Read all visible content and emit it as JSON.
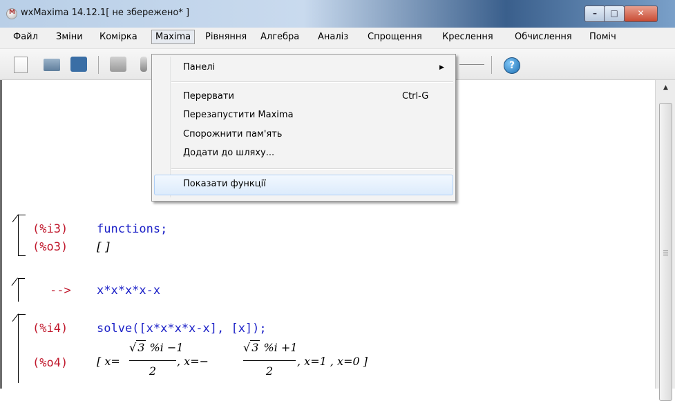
{
  "window": {
    "title": "wxMaxima 14.12.1[ не збережено* ]",
    "controls": {
      "minimize": "–",
      "maximize": "□",
      "close": "✕"
    }
  },
  "menubar": {
    "items": [
      "Файл",
      "Зміни",
      "Комірка",
      "Maxima",
      "Рівняння",
      "Алгебра",
      "Аналіз",
      "Спрощення",
      "Креслення",
      "Обчислення",
      "Поміч"
    ],
    "active": "Maxima"
  },
  "toolbar": {
    "icons": [
      "new-document-icon",
      "open-folder-icon",
      "save-icon",
      "print-icon",
      "settings-icon",
      "help-icon"
    ],
    "help_glyph": "?"
  },
  "dropdown": {
    "items": [
      {
        "label": "Панелі",
        "submenu_arrow": "▶"
      },
      {
        "label": "Перервати",
        "shortcut": "Ctrl-G"
      },
      {
        "label": "Перезапустити Maxima"
      },
      {
        "label": "Спорожнити пам'ять"
      },
      {
        "label": "Додати до шляху..."
      },
      {
        "label": "Показати функції",
        "highlighted": true
      }
    ]
  },
  "worksheet": {
    "cell1": {
      "input_label": "(%i3)",
      "input": "functions;",
      "output_label": "(%o3)",
      "output": "[ ]"
    },
    "cell2": {
      "prompt": "-->",
      "input": "x*x*x*x-x"
    },
    "cell3": {
      "input_label": "(%i4)",
      "input": "solve([x*x*x*x-x], [x]);",
      "output_label": "(%o4)",
      "out_open": "[ x=",
      "frac1_sqrt": "3",
      "frac1_rest": " %i −1",
      "frac1_den": "2",
      "mid": ", x=−",
      "frac2_sqrt": "3",
      "frac2_rest": " %i +1",
      "frac2_den": "2",
      "tail": ", x=1 , x=0 ]",
      "radical": "√"
    }
  },
  "scrollbar": {
    "up_arrow": "▲"
  }
}
